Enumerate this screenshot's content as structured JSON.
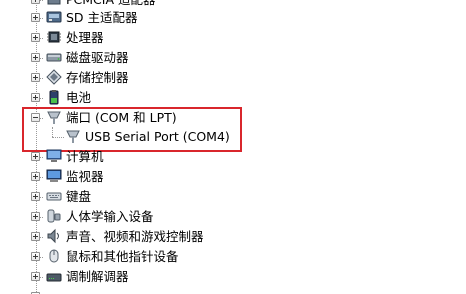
{
  "tree": {
    "items": [
      {
        "label": "PCMCIA 适配器",
        "icon": "pcmcia-icon",
        "expanded": false
      },
      {
        "label": "SD 主适配器",
        "icon": "sd-card-icon",
        "expanded": false
      },
      {
        "label": "处理器",
        "icon": "processor-icon",
        "expanded": false
      },
      {
        "label": "磁盘驱动器",
        "icon": "disk-drive-icon",
        "expanded": false
      },
      {
        "label": "存储控制器",
        "icon": "storage-controller-icon",
        "expanded": false
      },
      {
        "label": "电池",
        "icon": "battery-icon",
        "expanded": false
      },
      {
        "label": "端口 (COM 和 LPT)",
        "icon": "port-icon",
        "expanded": true
      },
      {
        "label": "计算机",
        "icon": "computer-icon",
        "expanded": false
      },
      {
        "label": "监视器",
        "icon": "monitor-icon",
        "expanded": false
      },
      {
        "label": "键盘",
        "icon": "keyboard-icon",
        "expanded": false
      },
      {
        "label": "人体学输入设备",
        "icon": "hid-icon",
        "expanded": false
      },
      {
        "label": "声音、视频和游戏控制器",
        "icon": "sound-icon",
        "expanded": false
      },
      {
        "label": "鼠标和其他指针设备",
        "icon": "mouse-icon",
        "expanded": false
      },
      {
        "label": "调制解调器",
        "icon": "modem-icon",
        "expanded": false
      }
    ],
    "ports_children": [
      {
        "label": "USB Serial Port (COM4)",
        "icon": "serial-port-icon"
      }
    ]
  },
  "colors": {
    "highlight_border": "#d9262c",
    "tree_line": "#9a9a9a",
    "text": "#000000"
  }
}
